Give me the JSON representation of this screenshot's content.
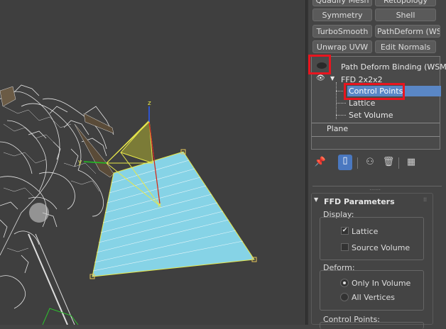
{
  "modifier_buttons": {
    "quadify_mesh": "Quadify Mesh",
    "retopology": "Retopology",
    "symmetry": "Symmetry",
    "shell": "Shell",
    "turbosmooth": "TurboSmooth",
    "pathdeform": "PathDeform (WSM",
    "unwrap_uvw": "Unwrap UVW",
    "edit_normals": "Edit Normals"
  },
  "modifier_stack": {
    "items": [
      {
        "label": "Path Deform Binding (WSM)"
      },
      {
        "label": "FFD 2x2x2"
      },
      {
        "label": "Control Points",
        "selected": true
      },
      {
        "label": "Lattice"
      },
      {
        "label": "Set Volume"
      },
      {
        "label": "Plane"
      }
    ]
  },
  "stack_toolbar": {
    "icons": [
      "pin-stack-icon",
      "show-end-result-icon",
      "make-unique-icon",
      "remove-modifier-icon",
      "configure-sets-icon"
    ]
  },
  "ffd_parameters": {
    "title": "FFD Parameters",
    "display_label": "Display:",
    "lattice_label": "Lattice",
    "lattice_checked": true,
    "source_volume_label": "Source Volume",
    "source_volume_checked": false,
    "deform_label": "Deform:",
    "only_in_volume_label": "Only In Volume",
    "all_vertices_label": "All Vertices",
    "deform_selected": "Only In Volume",
    "control_points_label": "Control Points:"
  },
  "gizmo": {
    "axis_z_label": "z",
    "axis_y_label": "y",
    "axis_x_label": "x"
  },
  "colors": {
    "highlight": "#5a87c6",
    "annotation_red": "#e8151f",
    "plane_fill": "#86d3e6",
    "lattice_yellow": "#e8e84a"
  }
}
